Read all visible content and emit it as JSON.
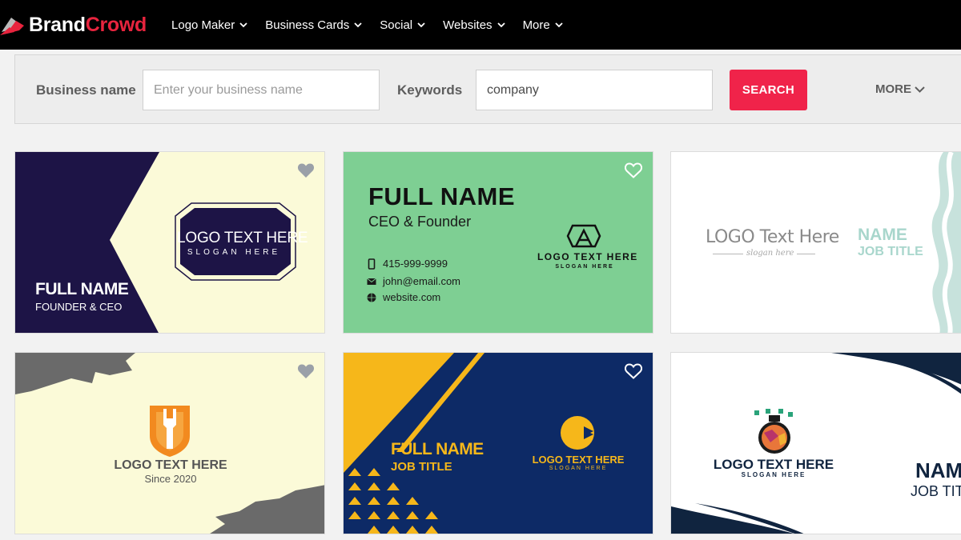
{
  "brand": {
    "name_main": "Brand",
    "name_accent": "Crowd"
  },
  "nav": {
    "items": [
      {
        "label": "Logo Maker"
      },
      {
        "label": "Business Cards"
      },
      {
        "label": "Social"
      },
      {
        "label": "Websites"
      },
      {
        "label": "More"
      }
    ]
  },
  "search": {
    "business_label": "Business name",
    "business_placeholder": "Enter your business name",
    "keywords_label": "Keywords",
    "keywords_value": "company",
    "button_label": "SEARCH",
    "more_label": "MORE"
  },
  "cards": {
    "c1": {
      "logo_text": "LOGO TEXT HERE",
      "slogan": "SLOGAN HERE",
      "name": "FULL NAME",
      "title": "FOUNDER & CEO"
    },
    "c2": {
      "name": "FULL NAME",
      "title": "CEO & Founder",
      "phone": "415-999-9999",
      "email": "john@email.com",
      "website": "website.com",
      "logo_text": "LOGO TEXT HERE",
      "slogan": "SLOGAN HERE"
    },
    "c3": {
      "logo_text": "LOGO Text Here",
      "slogan": "slogan here",
      "name": "NAME",
      "title": "JOB TITLE"
    },
    "c4": {
      "logo_text": "LOGO TEXT HERE",
      "since": "Since 2020"
    },
    "c5": {
      "name": "FULL NAME",
      "title": "JOB TITLE",
      "logo_text": "LOGO TEXT HERE",
      "slogan": "SLOGAN HERE"
    },
    "c6": {
      "logo_text": "LOGO TEXT HERE",
      "slogan": "SLOGAN HERE",
      "name": "NAME",
      "title": "JOB TITLE"
    }
  },
  "colors": {
    "brand_red": "#e8243e",
    "search_button": "#f0234a",
    "card1_dark": "#1d1446",
    "card2_green": "#7ecf93",
    "card5_navy": "#0d2a66",
    "card5_yellow": "#f6b71a"
  }
}
